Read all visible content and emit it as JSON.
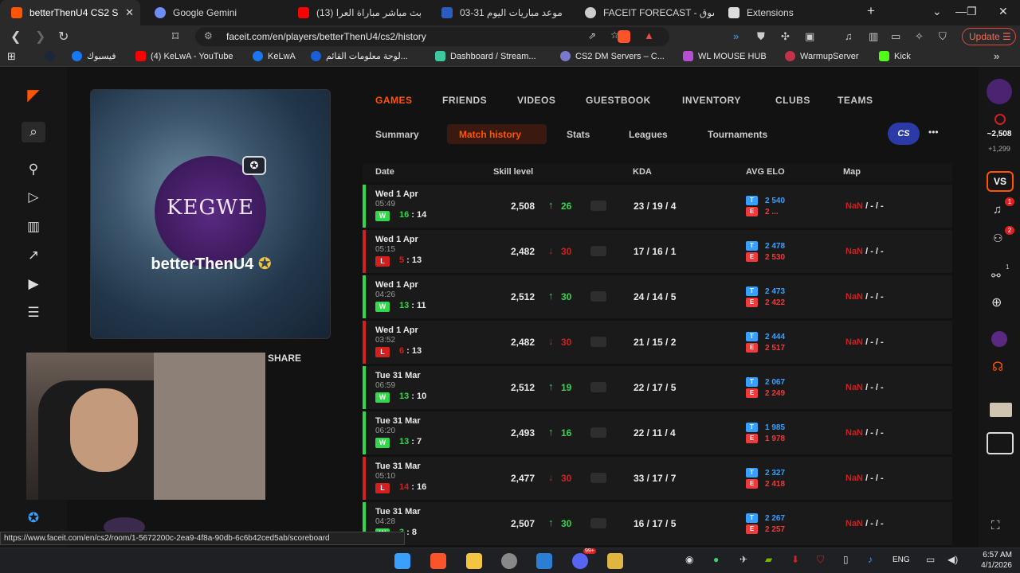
{
  "browser": {
    "tabs": [
      {
        "title": "betterThenU4 CS2 S",
        "active": true,
        "color": "#ff5500"
      },
      {
        "title": "Google Gemini",
        "active": false,
        "color": "#6f8cff"
      },
      {
        "title": "(13) بث مباشر مباراة العرا",
        "active": false,
        "color": "#ff0000"
      },
      {
        "title": "موعد مباريات اليوم 31-03",
        "active": false,
        "color": "#2b5cc2"
      },
      {
        "title": "FACEIT FORECAST - سوق",
        "active": false,
        "color": "#cccccc"
      },
      {
        "title": "Extensions",
        "active": false,
        "color": "#dddddd"
      }
    ],
    "new_tab": "+",
    "url": "faceit.com/en/players/betterThenU4/cs2/history",
    "update_label": "Update",
    "bookmarks": [
      {
        "label": "فيسبوك",
        "color": "#1877f2"
      },
      {
        "label": "(4) KeLwA - YouTube",
        "color": "#ff0000"
      },
      {
        "label": "KeLwA",
        "color": "#1877f2"
      },
      {
        "label": "لوحة معلومات القائم...",
        "color": "#1a5fd6"
      },
      {
        "label": "Dashboard / Stream...",
        "color": "#3cc9a0"
      },
      {
        "label": "CS2 DM Servers – C...",
        "color": "#7a7acc"
      },
      {
        "label": "WL MOUSE HUB",
        "color": "#b54fcf"
      },
      {
        "label": "WarmupServer",
        "color": "#c0334b"
      },
      {
        "label": "Kick",
        "color": "#53fc18"
      }
    ]
  },
  "profile": {
    "logo_text": "KEGWE",
    "name": "betterThenU4",
    "share_label": "SHARE"
  },
  "top_tabs": [
    "GAMES",
    "FRIENDS",
    "VIDEOS",
    "GUESTBOOK",
    "INVENTORY",
    "CLUBS",
    "TEAMS"
  ],
  "sub_tabs": [
    "Summary",
    "Match history",
    "Stats",
    "Leagues",
    "Tournaments"
  ],
  "cs_badge": "CS",
  "more_label": "•••",
  "columns": {
    "date": "Date",
    "skill": "Skill level",
    "kda": "KDA",
    "avg_elo": "AVG ELO",
    "map": "Map"
  },
  "team_labels": {
    "t": "T",
    "e": "E"
  },
  "matches": [
    {
      "date": "Wed 1 Apr",
      "time": "05:49",
      "result": "W",
      "score_a": "16",
      "score_b": "14",
      "elo": "2,508",
      "change": "26",
      "win": true,
      "kda": "23 / 19 / 4",
      "avg_t": "2 540",
      "avg_e": "2 ...",
      "map_nan": "NaN",
      "map_rest": "/ - / -"
    },
    {
      "date": "Wed 1 Apr",
      "time": "05:15",
      "result": "L",
      "score_a": "5",
      "score_b": "13",
      "elo": "2,482",
      "change": "30",
      "win": false,
      "kda": "17 / 16 / 1",
      "avg_t": "2 478",
      "avg_e": "2 530",
      "map_nan": "NaN",
      "map_rest": "/ - / -"
    },
    {
      "date": "Wed 1 Apr",
      "time": "04:26",
      "result": "W",
      "score_a": "13",
      "score_b": "11",
      "elo": "2,512",
      "change": "30",
      "win": true,
      "kda": "24 / 14 / 5",
      "avg_t": "2 473",
      "avg_e": "2 422",
      "map_nan": "NaN",
      "map_rest": "/ - / -"
    },
    {
      "date": "Wed 1 Apr",
      "time": "03:52",
      "result": "L",
      "score_a": "6",
      "score_b": "13",
      "elo": "2,482",
      "change": "30",
      "win": false,
      "kda": "21 / 15 / 2",
      "avg_t": "2 444",
      "avg_e": "2 517",
      "map_nan": "NaN",
      "map_rest": "/ - / -"
    },
    {
      "date": "Tue 31 Mar",
      "time": "06:59",
      "result": "W",
      "score_a": "13",
      "score_b": "10",
      "elo": "2,512",
      "change": "19",
      "win": true,
      "kda": "22 / 17 / 5",
      "avg_t": "2 067",
      "avg_e": "2 249",
      "map_nan": "NaN",
      "map_rest": "/ - / -"
    },
    {
      "date": "Tue 31 Mar",
      "time": "06:20",
      "result": "W",
      "score_a": "13",
      "score_b": "7",
      "elo": "2,493",
      "change": "16",
      "win": true,
      "kda": "22 / 11 / 4",
      "avg_t": "1 985",
      "avg_e": "1 978",
      "map_nan": "NaN",
      "map_rest": "/ - / -"
    },
    {
      "date": "Tue 31 Mar",
      "time": "05:10",
      "result": "L",
      "score_a": "14",
      "score_b": "16",
      "elo": "2,477",
      "change": "30",
      "win": false,
      "kda": "33 / 17 / 7",
      "avg_t": "2 327",
      "avg_e": "2 418",
      "map_nan": "NaN",
      "map_rest": "/ - / -"
    },
    {
      "date": "Tue 31 Mar",
      "time": "04:28",
      "result": "W",
      "score_a": "3",
      "score_b": "8",
      "elo": "2,507",
      "change": "30",
      "win": true,
      "kda": "16 / 17 / 5",
      "avg_t": "2 267",
      "avg_e": "2 257",
      "map_nan": "NaN",
      "map_rest": "/ - / -"
    }
  ],
  "right_rail": {
    "elo": "~2,508",
    "elo_diff": "+1,299",
    "vs": "VS",
    "notif_count": "1",
    "friends_count": "2",
    "party_count": "1"
  },
  "status_url": "https://www.faceit.com/en/cs2/room/1-5672200c-2ea9-4f8a-90db-6c6b42ced5ab/scoreboard",
  "taskbar": {
    "lang": "ENG",
    "time": "6:57 AM",
    "date": "4/1/2026",
    "discord_badge": "99+"
  },
  "colors": {
    "faceit_orange": "#ff5500",
    "win": "#32d74b",
    "loss": "#d21f1f",
    "t_blue": "#3aa0ff",
    "e_red": "#ef3b3b"
  },
  "icons": [
    "faceit-logo-icon",
    "search-icon",
    "eye-icon",
    "arrow-up-icon",
    "arrow-down-icon"
  ]
}
